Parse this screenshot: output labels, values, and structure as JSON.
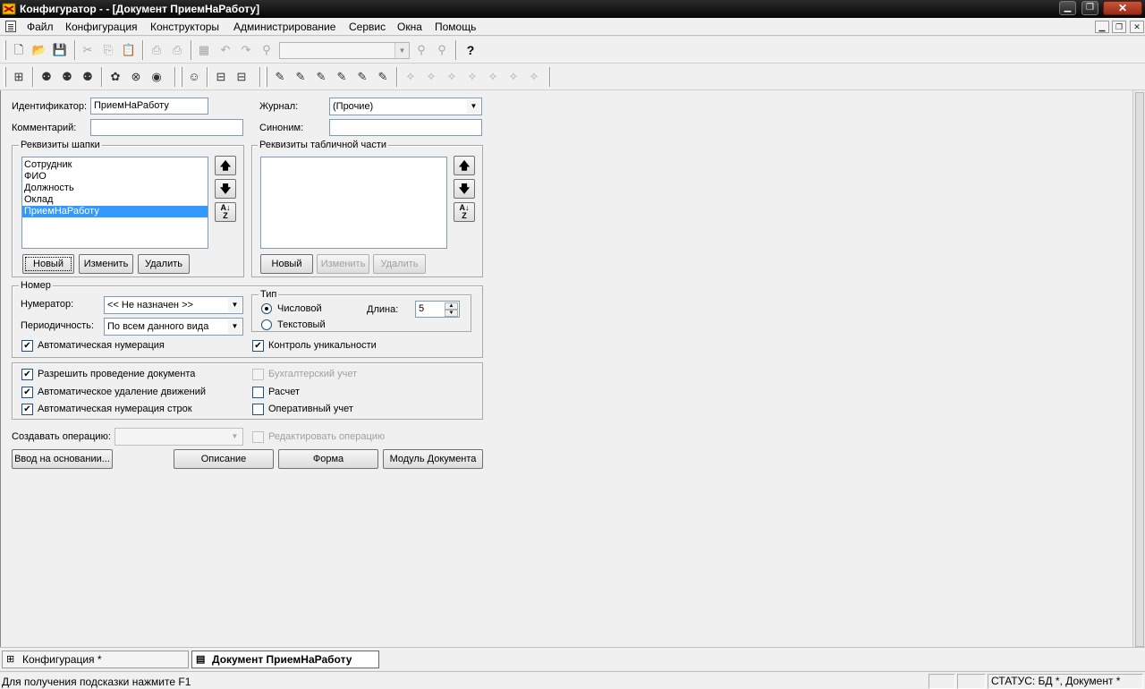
{
  "window": {
    "title": "Конфигуратор -  - [Документ ПриемНаРаботу]"
  },
  "menu": {
    "items": [
      "Файл",
      "Конфигурация",
      "Конструкторы",
      "Администрирование",
      "Сервис",
      "Окна",
      "Помощь"
    ]
  },
  "form": {
    "identifier_label": "Идентификатор:",
    "identifier_value": "ПриемНаРаботу",
    "comment_label": "Комментарий:",
    "comment_value": "",
    "journal_label": "Журнал:",
    "journal_value": "(Прочие)",
    "synonym_label": "Синоним:",
    "synonym_value": ""
  },
  "header_attrs": {
    "title": "Реквизиты шапки",
    "items": [
      "Сотрудник",
      "ФИО",
      "Должность",
      "Оклад",
      "ПриемНаРаботу"
    ],
    "selected": "ПриемНаРаботу",
    "btn_new": "Новый",
    "btn_edit": "Изменить",
    "btn_delete": "Удалить"
  },
  "table_attrs": {
    "title": "Реквизиты табличной части",
    "btn_new": "Новый",
    "btn_edit": "Изменить",
    "btn_delete": "Удалить"
  },
  "numbering": {
    "title": "Номер",
    "numerator_label": "Нумератор:",
    "numerator_value": "<< Не назначен >>",
    "periodicity_label": "Периодичность:",
    "periodicity_value": "По всем данного вида",
    "type_title": "Тип",
    "type_numeric": "Числовой",
    "type_text": "Текстовый",
    "length_label": "Длина:",
    "length_value": "5",
    "auto_numbering": "Автоматическая нумерация",
    "uniqueness": "Контроль уникальности"
  },
  "options": {
    "allow_posting": "Разрешить проведение документа",
    "auto_delete_movements": "Автоматическое удаление движений",
    "auto_row_numbering": "Автоматическая нумерация строк",
    "accounting": "Бухгалтерский учет",
    "calculation": "Расчет",
    "operational": "Оперативный учет"
  },
  "operation": {
    "create_label": "Создавать операцию:",
    "create_value": "",
    "edit_operation": "Редактировать операцию"
  },
  "bottom_buttons": {
    "based_on": "Ввод на основании...",
    "description": "Описание",
    "form": "Форма",
    "module": "Модуль Документа"
  },
  "tabs": [
    {
      "label": "Конфигурация *"
    },
    {
      "label": "Документ ПриемНаРаботу"
    }
  ],
  "status": {
    "hint": "Для получения подсказки нажмите F1",
    "panel": "СТАТУС: БД *, Документ *"
  }
}
